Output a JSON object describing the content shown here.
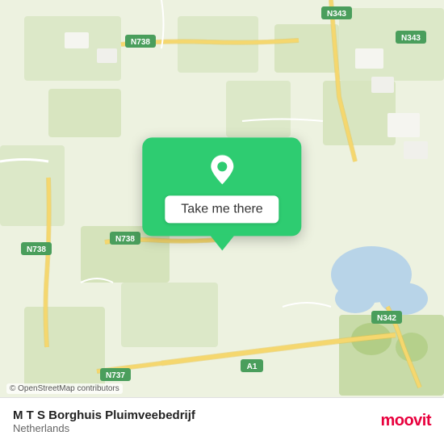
{
  "map": {
    "attribution": "© OpenStreetMap contributors"
  },
  "popup": {
    "button_label": "Take me there"
  },
  "bottom_bar": {
    "place_name": "M T S Borghuis Pluimveebedrijf",
    "place_country": "Netherlands"
  },
  "moovit": {
    "logo_text": "moovit"
  },
  "road_labels": {
    "n738_top": "N738",
    "n343_top": "N343",
    "n343_right": "N343",
    "n738_left": "N738",
    "n738_mid": "N738",
    "n342": "N342",
    "a1": "A1",
    "n737": "N737"
  }
}
